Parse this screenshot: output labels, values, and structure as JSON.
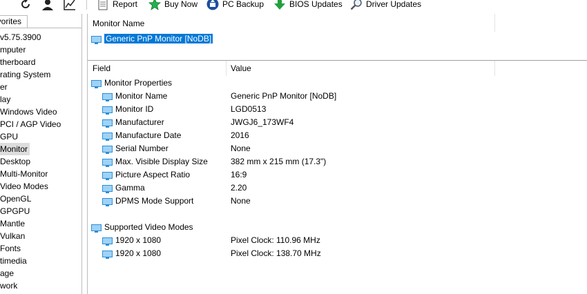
{
  "toolbar": {
    "report_label": "Report",
    "buy_now_label": "Buy Now",
    "pc_backup_label": "PC Backup",
    "bios_updates_label": "BIOS Updates",
    "driver_updates_label": "Driver Updates"
  },
  "sidebar": {
    "tab_label": "ivorites",
    "items": [
      "v5.75.3900",
      "mputer",
      "therboard",
      "rating System",
      "er",
      "lay",
      "Windows Video",
      "PCI / AGP Video",
      "GPU",
      "Monitor",
      "Desktop",
      "Multi-Monitor",
      "Video Modes",
      "OpenGL",
      "GPGPU",
      "Mantle",
      "Vulkan",
      "Fonts",
      "timedia",
      "age",
      "work"
    ]
  },
  "device_list": {
    "header": "Monitor Name",
    "selected_item": "Generic PnP Monitor [NoDB]"
  },
  "details": {
    "field_header": "Field",
    "value_header": "Value",
    "groups": [
      {
        "title": "Monitor Properties",
        "rows": [
          {
            "field": "Monitor Name",
            "value": "Generic PnP Monitor [NoDB]"
          },
          {
            "field": "Monitor ID",
            "value": "LGD0513"
          },
          {
            "field": "Manufacturer",
            "value": "JWGJ6_173WF4"
          },
          {
            "field": "Manufacture Date",
            "value": "2016"
          },
          {
            "field": "Serial Number",
            "value": "None"
          },
          {
            "field": "Max. Visible Display Size",
            "value": "382 mm x 215 mm (17.3\")"
          },
          {
            "field": "Picture Aspect Ratio",
            "value": "16:9"
          },
          {
            "field": "Gamma",
            "value": "2.20"
          },
          {
            "field": "DPMS Mode Support",
            "value": "None"
          }
        ]
      },
      {
        "title": "Supported Video Modes",
        "rows": [
          {
            "field": "1920 x 1080",
            "value": "Pixel Clock: 110.96 MHz"
          },
          {
            "field": "1920 x 1080",
            "value": "Pixel Clock: 138.70 MHz"
          }
        ]
      }
    ]
  },
  "colors": {
    "selection_bg": "#0078d7",
    "selection_text": "#ffffff",
    "tree_selected_bg": "#dddddd",
    "monitor_icon_blue": "#2a8fd8"
  }
}
